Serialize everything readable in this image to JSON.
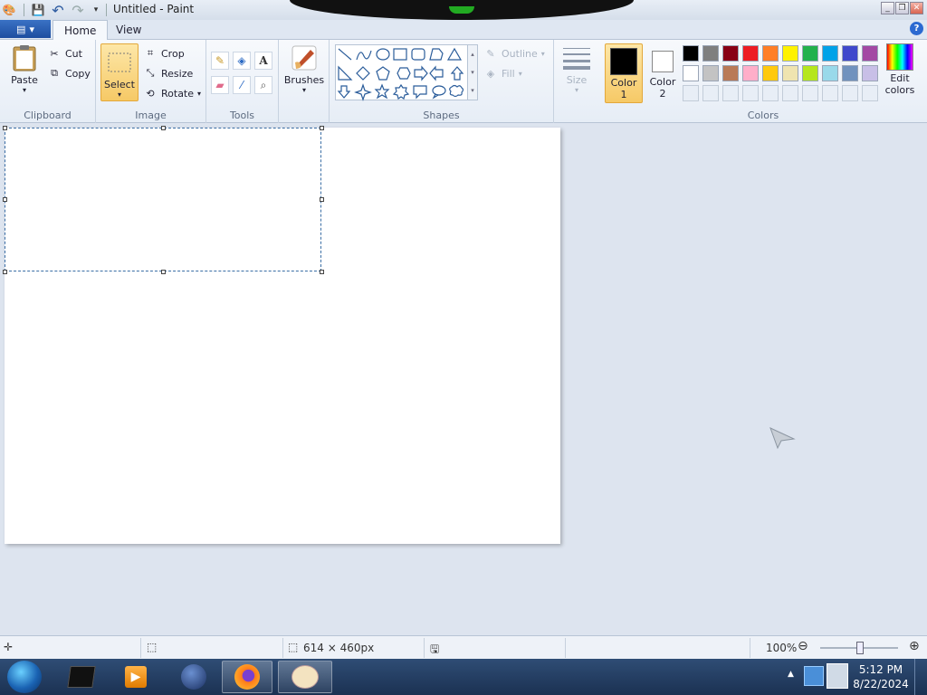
{
  "titlebar": {
    "title": "Untitled - Paint"
  },
  "tabs": {
    "home": "Home",
    "view": "View"
  },
  "clipboard": {
    "group": "Clipboard",
    "paste": "Paste",
    "cut": "Cut",
    "copy": "Copy"
  },
  "image": {
    "group": "Image",
    "select": "Select",
    "crop": "Crop",
    "resize": "Resize",
    "rotate": "Rotate"
  },
  "tools": {
    "group": "Tools"
  },
  "brushes": {
    "label": "Brushes"
  },
  "shapes": {
    "group": "Shapes",
    "outline": "Outline",
    "fill": "Fill"
  },
  "size": {
    "label": "Size"
  },
  "colors": {
    "group": "Colors",
    "color1": "Color\n1",
    "color1_a": "Color",
    "color1_b": "1",
    "color2_a": "Color",
    "color2_b": "2",
    "edit_a": "Edit",
    "edit_b": "colors",
    "primary": "#000000",
    "secondary": "#ffffff",
    "palette_row1": [
      "#000000",
      "#7f7f7f",
      "#880015",
      "#ed1c24",
      "#ff7f27",
      "#fff200",
      "#22b14c",
      "#00a2e8",
      "#3f48cc",
      "#a349a4"
    ],
    "palette_row2": [
      "#ffffff",
      "#c3c3c3",
      "#b97a57",
      "#ffaec9",
      "#ffc90e",
      "#efe4b0",
      "#b5e61d",
      "#99d9ea",
      "#7092be",
      "#c8bfe7"
    ]
  },
  "statusbar": {
    "dimensions": "614 × 460px",
    "zoom": "100%"
  },
  "taskbar": {
    "time": "5:12 PM",
    "date": "8/22/2024"
  }
}
